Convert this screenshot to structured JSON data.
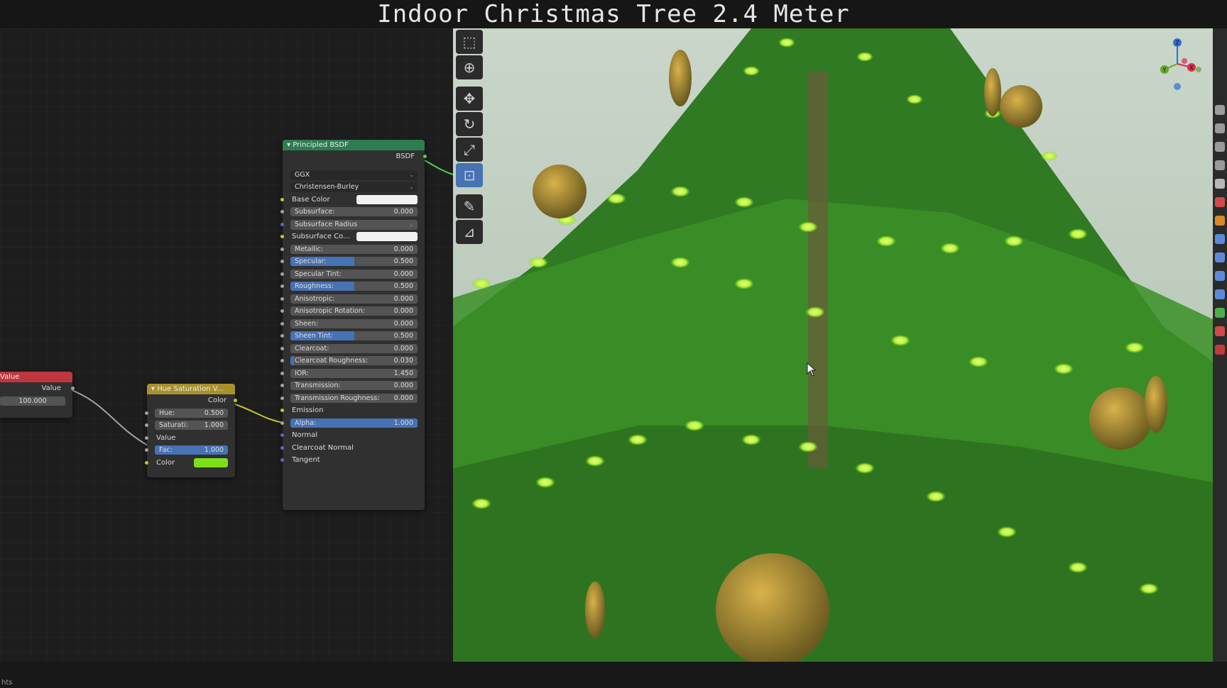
{
  "title": "Indoor Christmas Tree 2.4 Meter",
  "status": {
    "text": "hts"
  },
  "colors": {
    "value_header": "#c0363e",
    "hue_sat_header": "#a8912c",
    "bsdf_header": "#2e7d52",
    "base_color": "#f2f2f2",
    "subsurface_color": "#f2f2f2",
    "hue_sat_color": "#7ddf1a",
    "field_fill": "#4772b3"
  },
  "nodes": {
    "value": {
      "title": "Value",
      "output_label": "Value",
      "value": "100.000"
    },
    "hue_sat": {
      "title": "Hue Saturation V...",
      "output_label": "Color",
      "hue": {
        "label": "Hue:",
        "value": "0.500"
      },
      "saturation": {
        "label": "Saturati:",
        "value": "1.000"
      },
      "value_input_label": "Value",
      "fac": {
        "label": "Fac:",
        "value": "1.000",
        "fraction": 1.0
      },
      "color_label": "Color"
    },
    "bsdf": {
      "title": "Principled BSDF",
      "output_label": "BSDF",
      "distribution": "GGX",
      "subsurface_method": "Christensen-Burley",
      "base_color_label": "Base Color",
      "subsurface": {
        "label": "Subsurface:",
        "value": "0.000",
        "fraction": 0.0
      },
      "subsurface_radius": "Subsurface Radius",
      "subsurface_color_label": "Subsurface Co...",
      "metallic": {
        "label": "Metallic:",
        "value": "0.000",
        "fraction": 0.0
      },
      "specular": {
        "label": "Specular:",
        "value": "0.500",
        "fraction": 0.5
      },
      "specular_tint": {
        "label": "Specular Tint:",
        "value": "0.000",
        "fraction": 0.0
      },
      "roughness": {
        "label": "Roughness:",
        "value": "0.500",
        "fraction": 0.5
      },
      "anisotropic": {
        "label": "Anisotropic:",
        "value": "0.000",
        "fraction": 0.0
      },
      "anisotropic_rotation": {
        "label": "Anisotropic Rotation:",
        "value": "0.000",
        "fraction": 0.0
      },
      "sheen": {
        "label": "Sheen:",
        "value": "0.000",
        "fraction": 0.0
      },
      "sheen_tint": {
        "label": "Sheen Tint:",
        "value": "0.500",
        "fraction": 0.5
      },
      "clearcoat": {
        "label": "Clearcoat:",
        "value": "0.000",
        "fraction": 0.0
      },
      "clearcoat_roughness": {
        "label": "Clearcoat Roughness:",
        "value": "0.030",
        "fraction": 0.03
      },
      "ior": {
        "label": "IOR:",
        "value": "1.450"
      },
      "transmission": {
        "label": "Transmission:",
        "value": "0.000",
        "fraction": 0.0
      },
      "transmission_roughness": {
        "label": "Transmission Roughness:",
        "value": "0.000",
        "fraction": 0.0
      },
      "emission_label": "Emission",
      "alpha": {
        "label": "Alpha:",
        "value": "1.000",
        "fraction": 1.0
      },
      "normal_label": "Normal",
      "clearcoat_normal_label": "Clearcoat Normal",
      "tangent_label": "Tangent"
    }
  },
  "viewport": {
    "tools": [
      "select-box-icon",
      "cursor-icon",
      "move-icon",
      "rotate-icon",
      "scale-icon",
      "transform-icon",
      "annotate-icon",
      "measure-icon"
    ],
    "gizmo_labels": {
      "x": "X",
      "y": "Y",
      "z": "Z"
    }
  }
}
